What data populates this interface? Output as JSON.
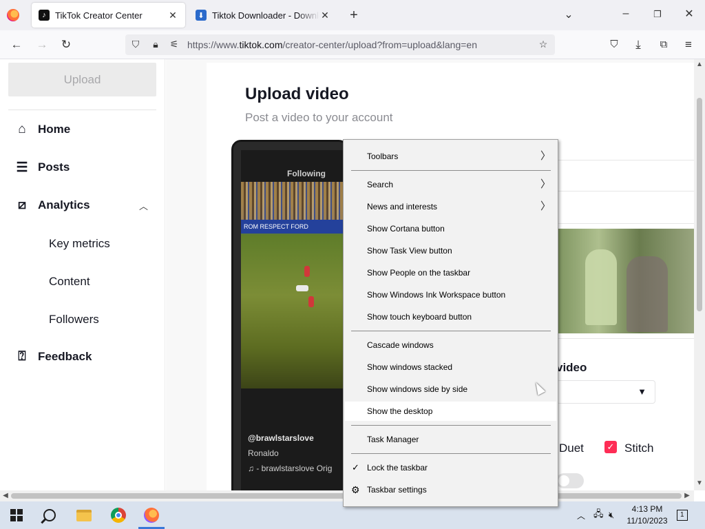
{
  "browser": {
    "tabs": [
      {
        "label": "TikTok Creator Center",
        "favicon": "tiktok-icon",
        "active": true
      },
      {
        "label": "Tiktok Downloader - Download",
        "favicon": "download-icon",
        "active": false
      }
    ],
    "url_prefix": "https://www.",
    "url_domain": "tiktok.com",
    "url_rest": "/creator-center/upload?from=upload&lang=en"
  },
  "sidebar": {
    "upload_label": "Upload",
    "items": [
      {
        "label": "Home",
        "icon": "home-icon"
      },
      {
        "label": "Posts",
        "icon": "list-icon"
      },
      {
        "label": "Analytics",
        "icon": "chart-icon"
      },
      {
        "label": "Feedback",
        "icon": "feedback-icon"
      }
    ],
    "analytics_sub": [
      "Key metrics",
      "Content",
      "Followers"
    ]
  },
  "main": {
    "title": "Upload video",
    "subtitle": "Post a video to your account",
    "phone": {
      "tab_label": "Following",
      "creator": "@brawlstarslove",
      "name": "Ronaldo",
      "sound": "♫  - brawlstarslove Orig",
      "ad_text": "ROM  RESPECT     FORD"
    },
    "video_label": "video",
    "duet_label": "Duet",
    "stitch_label": "Stitch"
  },
  "context_menu": {
    "items": [
      {
        "label": "Toolbars",
        "submenu": true
      },
      {
        "label": "Search",
        "submenu": true
      },
      {
        "label": "News and interests",
        "submenu": true
      },
      {
        "label": "Show Cortana button"
      },
      {
        "label": "Show Task View button"
      },
      {
        "label": "Show People on the taskbar"
      },
      {
        "label": "Show Windows Ink Workspace button"
      },
      {
        "label": "Show touch keyboard button"
      },
      {
        "label": "Cascade windows"
      },
      {
        "label": "Show windows stacked"
      },
      {
        "label": "Show windows side by side"
      },
      {
        "label": "Show the desktop",
        "hovered": true
      },
      {
        "label": "Task Manager"
      },
      {
        "label": "Lock the taskbar",
        "checked": true
      },
      {
        "label": "Taskbar settings",
        "icon": "gear-icon"
      }
    ]
  },
  "taskbar": {
    "time": "4:13 PM",
    "date": "11/10/2023",
    "notification_count": "1"
  },
  "colors": {
    "accent": "#fe2c55",
    "taskbar": "#d9e2ee",
    "menu_bg": "#f2f2f2"
  }
}
